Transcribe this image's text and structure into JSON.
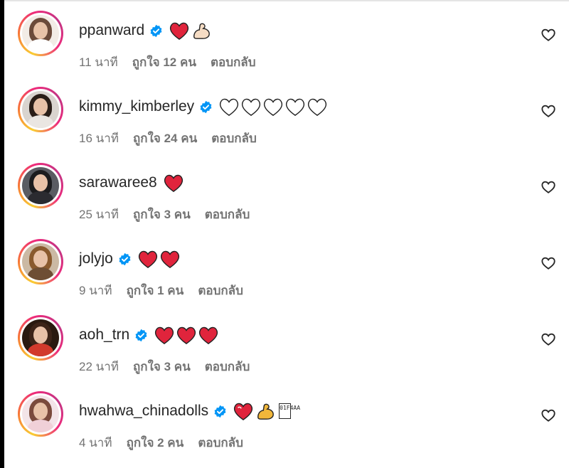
{
  "colors": {
    "heart_red": "#e0243c",
    "verified_blue": "#0095f6",
    "meta_gray": "#737373",
    "text": "#262626"
  },
  "comments": [
    {
      "username": "ppanward",
      "verified": true,
      "emojis": [
        "red-heart",
        "flexed-biceps-light"
      ],
      "time": "11 นาที",
      "likes": "ถูกใจ 12 คน",
      "reply": "ตอบกลับ"
    },
    {
      "username": "kimmy_kimberley",
      "verified": true,
      "emojis": [
        "white-heart",
        "white-heart",
        "white-heart",
        "white-heart",
        "white-heart"
      ],
      "time": "16 นาที",
      "likes": "ถูกใจ 24 คน",
      "reply": "ตอบกลับ"
    },
    {
      "username": "sarawaree8",
      "verified": false,
      "emojis": [
        "red-heart"
      ],
      "time": "25 นาที",
      "likes": "ถูกใจ 3 คน",
      "reply": "ตอบกลับ"
    },
    {
      "username": "jolyjo",
      "verified": true,
      "emojis": [
        "red-heart",
        "red-heart"
      ],
      "time": "9 นาที",
      "likes": "ถูกใจ 1 คน",
      "reply": "ตอบกลับ"
    },
    {
      "username": "aoh_trn",
      "verified": true,
      "emojis": [
        "red-heart",
        "red-heart",
        "red-heart"
      ],
      "time": "22 นาที",
      "likes": "ถูกใจ 3 คน",
      "reply": "ตอบกลับ"
    },
    {
      "username": "hwahwa_chinadolls",
      "verified": true,
      "emojis": [
        "heart-on-fire",
        "flexed-biceps"
      ],
      "unknown_glyph": "01F4AA",
      "time": "4 นาที",
      "likes": "ถูกใจ 2 คน",
      "reply": "ตอบกลับ"
    }
  ]
}
